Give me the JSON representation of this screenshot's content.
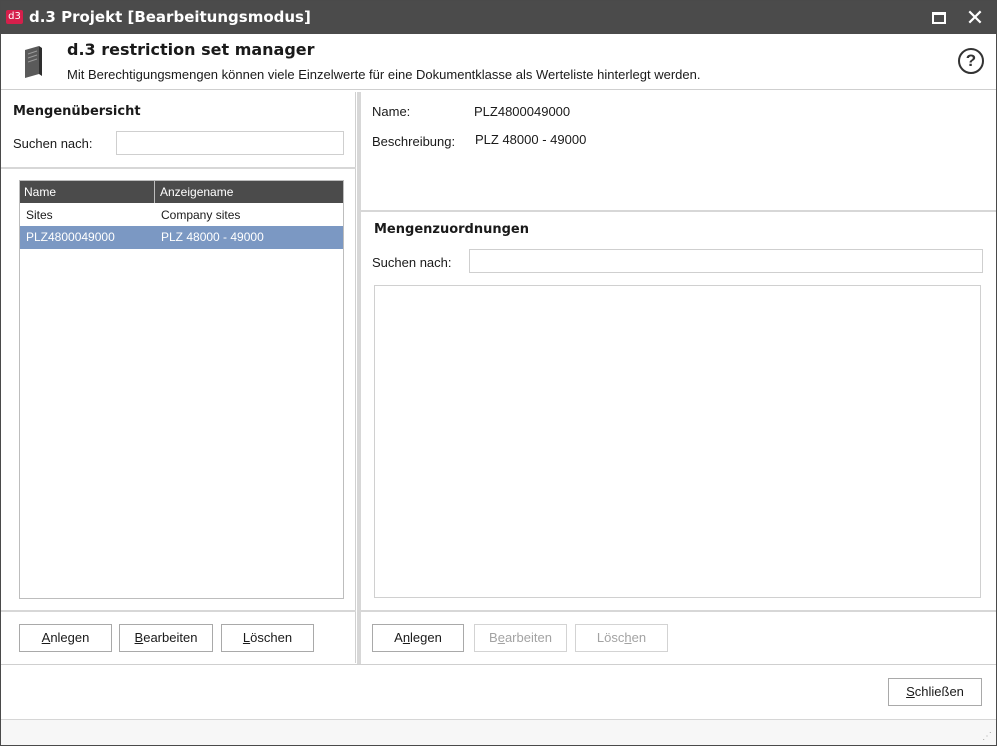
{
  "window": {
    "badge": "d3",
    "title": "d.3 Projekt [Bearbeitungsmodus]",
    "maximize_icon": "maximize-icon",
    "close_icon": "close-icon"
  },
  "header": {
    "icon": "book-icon",
    "title": "d.3 restriction set manager",
    "description": "Mit Berechtigungsmengen können viele Einzelwerte für eine Dokumentklasse als Werteliste hinterlegt werden.",
    "help_symbol": "?"
  },
  "left": {
    "section_title": "Mengenübersicht",
    "search_label": "Suchen nach:",
    "search_value": "",
    "list": {
      "columns": [
        "Name",
        "Anzeigename"
      ],
      "rows": [
        {
          "name": "Sites",
          "display": "Company sites",
          "selected": false
        },
        {
          "name": "PLZ4800049000",
          "display": "PLZ 48000 - 49000",
          "selected": true
        }
      ]
    },
    "buttons": {
      "create": {
        "prefix": "",
        "mnemonic": "A",
        "rest": "nlegen"
      },
      "edit": {
        "prefix": "",
        "mnemonic": "B",
        "rest": "earbeiten"
      },
      "delete": {
        "prefix": "",
        "mnemonic": "L",
        "rest": "öschen"
      }
    }
  },
  "right": {
    "name_label": "Name:",
    "name_value": "PLZ4800049000",
    "description_label": "Beschreibung:",
    "description_value": "PLZ 48000 - 49000",
    "section_title": "Mengenzuordnungen",
    "search_label": "Suchen nach:",
    "search_value": "",
    "buttons": {
      "create": {
        "prefix": "A",
        "mnemonic": "n",
        "rest": "legen"
      },
      "edit": {
        "prefix": "B",
        "mnemonic": "e",
        "rest": "arbeiten"
      },
      "delete": {
        "prefix": "Lösc",
        "mnemonic": "h",
        "rest": "en"
      }
    }
  },
  "footer": {
    "close": {
      "prefix": "",
      "mnemonic": "S",
      "rest": "chließen"
    }
  },
  "statusbar": {
    "grip_icon": "resize-grip-icon"
  }
}
